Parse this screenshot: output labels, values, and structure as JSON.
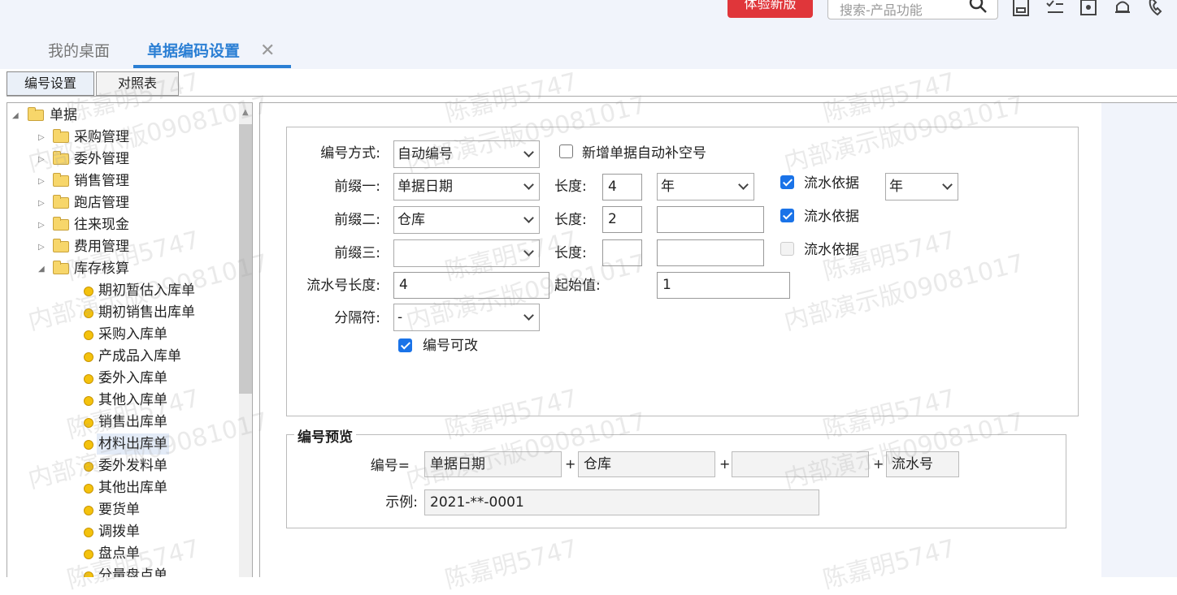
{
  "header": {
    "trial_button": "体验新版",
    "search_placeholder": "搜索-产品功能"
  },
  "tabs": {
    "home": "我的桌面",
    "active": "单据编码设置",
    "close": "✕"
  },
  "subtabs": [
    "编号设置",
    "对照表"
  ],
  "tree": {
    "root": "单据",
    "folders": [
      "采购管理",
      "委外管理",
      "销售管理",
      "跑店管理",
      "往来现金",
      "费用管理",
      "库存核算"
    ],
    "docs": [
      "期初暂估入库单",
      "期初销售出库单",
      "采购入库单",
      "产成品入库单",
      "委外入库单",
      "其他入库单",
      "销售出库单",
      "材料出库单",
      "委外发料单",
      "其他出库单",
      "要货单",
      "调拨单",
      "盘点单",
      "分量盘点单"
    ],
    "selected_doc": "材料出库单"
  },
  "form": {
    "numbering_method_label": "编号方式:",
    "numbering_method_value": "自动编号",
    "autofill_label": "新增单据自动补空号",
    "autofill_checked": false,
    "prefix1_label": "前缀一:",
    "prefix1_value": "单据日期",
    "prefix1_length_label": "长度:",
    "prefix1_length": "4",
    "prefix1_unit": "年",
    "prefix1_serial_label": "流水依据",
    "prefix1_serial_checked": true,
    "prefix1_serial_value": "年",
    "prefix2_label": "前缀二:",
    "prefix2_value": "仓库",
    "prefix2_length_label": "长度:",
    "prefix2_length": "2",
    "prefix2_extra": "",
    "prefix2_serial_label": "流水依据",
    "prefix2_serial_checked": true,
    "prefix3_label": "前缀三:",
    "prefix3_value": "",
    "prefix3_length_label": "长度:",
    "prefix3_length": "",
    "prefix3_extra": "",
    "prefix3_serial_label": "流水依据",
    "prefix3_serial_checked": false,
    "serial_length_label": "流水号长度:",
    "serial_length": "4",
    "start_value_label": "起始值:",
    "start_value": "1",
    "separator_label": "分隔符:",
    "separator_value": "-",
    "editable_label": "编号可改",
    "editable_checked": true
  },
  "preview": {
    "legend": "编号预览",
    "number_label": "编号=",
    "part1": "单据日期",
    "part2": "仓库",
    "part3": "",
    "part4": "流水号",
    "plus": "+",
    "example_label": "示例:",
    "example_value": "2021-**-0001"
  },
  "watermark": {
    "line1": "陈嘉明5747",
    "line2": "内部演示版09081017"
  },
  "colors": {
    "accent": "#2b7fd4",
    "trial_button": "#e0363a",
    "checkbox": "#1a73e8"
  }
}
